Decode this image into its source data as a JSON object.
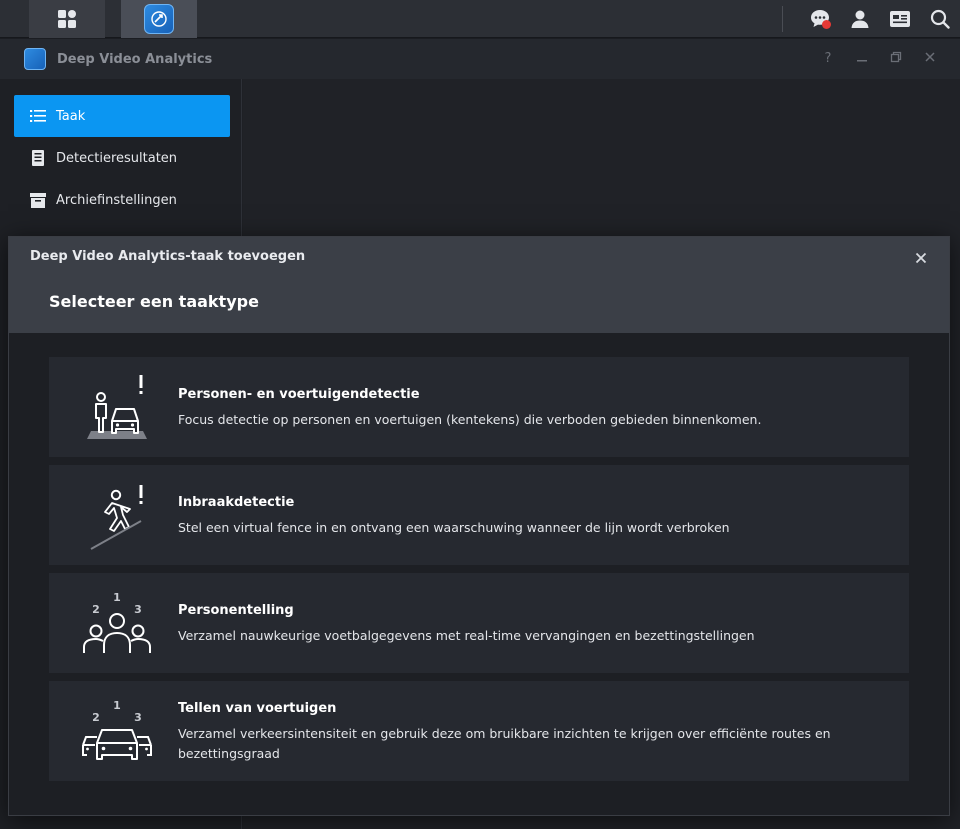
{
  "taskbar": {
    "icons": [
      "apps-grid-icon",
      "deep-video-analytics-app-icon",
      "chat-notification-icon",
      "user-icon",
      "widgets-icon",
      "search-icon"
    ]
  },
  "window": {
    "title": "Deep Video Analytics",
    "controls": {
      "help": "?"
    }
  },
  "sidebar": {
    "items": [
      {
        "label": "Taak",
        "icon": "list-icon",
        "active": true
      },
      {
        "label": "Detectieresultaten",
        "icon": "document-icon",
        "active": false
      },
      {
        "label": "Archiefinstellingen",
        "icon": "archive-box-icon",
        "active": false
      }
    ]
  },
  "modal": {
    "title": "Deep Video Analytics-taak toevoegen",
    "close": "×",
    "subtitle": "Selecteer een taaktype",
    "options": [
      {
        "title": "Personen- en voertuigendetectie",
        "description": "Focus detectie op personen en voertuigen (kentekens) die verboden gebieden binnenkomen.",
        "icon": "person-vehicle-alert-icon"
      },
      {
        "title": "Inbraakdetectie",
        "description": "Stel een virtual fence in en ontvang een waarschuwing wanneer de lijn wordt verbroken",
        "icon": "intrusion-line-icon"
      },
      {
        "title": "Personentelling",
        "description": "Verzamel nauwkeurige voetbalgegevens met real-time vervangingen en bezettingstellingen",
        "icon": "people-counting-icon",
        "numbers": [
          "1",
          "2",
          "3"
        ]
      },
      {
        "title": "Tellen van voertuigen",
        "description": "Verzamel verkeersintensiteit en gebruik deze om bruikbare inzichten te krijgen over efficiënte routes en bezettingsgraad",
        "icon": "vehicle-counting-icon",
        "numbers": [
          "1",
          "2",
          "3"
        ]
      }
    ]
  },
  "colors": {
    "accent": "#0b96f2",
    "notification": "#e53935"
  }
}
